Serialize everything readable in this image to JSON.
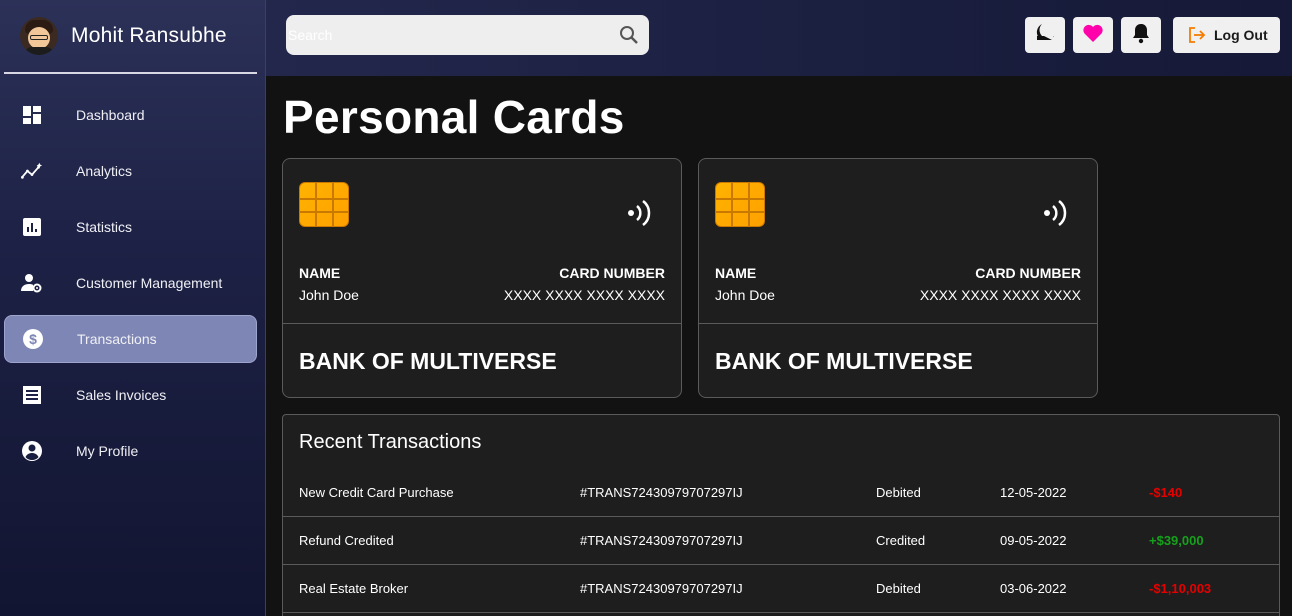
{
  "profile": {
    "name": "Mohit Ransubhe"
  },
  "nav": [
    {
      "label": "Dashboard",
      "icon": "dashboard-icon"
    },
    {
      "label": "Analytics",
      "icon": "analytics-icon"
    },
    {
      "label": "Statistics",
      "icon": "statistics-icon"
    },
    {
      "label": "Customer Management",
      "icon": "customer-management-icon"
    },
    {
      "label": "Transactions",
      "icon": "dollar-icon",
      "active": true
    },
    {
      "label": "Sales Invoices",
      "icon": "invoice-icon"
    },
    {
      "label": "My Profile",
      "icon": "account-circle-icon"
    }
  ],
  "search": {
    "placeholder": "Search"
  },
  "topbar": {
    "logout_label": "Log Out",
    "icons": [
      "moon-icon",
      "heart-icon",
      "bell-icon",
      "logout-icon"
    ]
  },
  "page": {
    "title": "Personal Cards"
  },
  "cards": [
    {
      "name_label": "NAME",
      "name": "John Doe",
      "number_label": "CARD NUMBER",
      "number": "XXXX XXXX XXXX XXXX",
      "bank": "BANK OF MULTIVERSE"
    },
    {
      "name_label": "NAME",
      "name": "John Doe",
      "number_label": "CARD NUMBER",
      "number": "XXXX XXXX XXXX XXXX",
      "bank": "BANK OF MULTIVERSE"
    }
  ],
  "transactions": {
    "title": "Recent Transactions",
    "rows": [
      {
        "description": "New Credit Card Purchase",
        "id": "#TRANS72430979707297IJ",
        "type": "Debited",
        "date": "12-05-2022",
        "amount": "-$140"
      },
      {
        "description": "Refund Credited",
        "id": "#TRANS72430979707297IJ",
        "type": "Credited",
        "date": "09-05-2022",
        "amount": "+$39,000"
      },
      {
        "description": "Real Estate Broker",
        "id": "#TRANS72430979707297IJ",
        "type": "Debited",
        "date": "03-06-2022",
        "amount": "-$1,10,003"
      }
    ]
  },
  "colors": {
    "accent_active": "#7d86b4",
    "debit": "#e50000",
    "credit": "#16a01c",
    "heart": "#ff00aa",
    "logout_icon": "#f57c00"
  }
}
